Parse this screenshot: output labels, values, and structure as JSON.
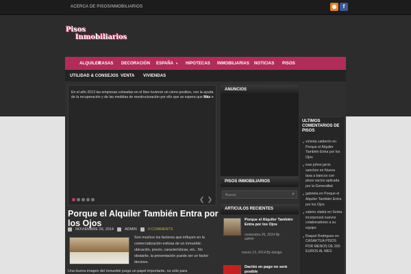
{
  "top": {
    "link": "ACERCA DE PISOSINMOBILIARIOS"
  },
  "social": {
    "rss": "rss-icon",
    "facebook": "f"
  },
  "logo": {
    "line1": "Pisos",
    "line2": "Inmobiliarios"
  },
  "nav": {
    "primary": [
      "ALQUILER",
      "CASAS",
      "DECORACIÓN",
      "ESPAÑA",
      "HIPOTECAS",
      "INMOBILIARIAS",
      "NOTICIAS",
      "PISOS"
    ],
    "dropdown_marker": "▼",
    "secondary": [
      "UTILIDAD & CONSEJOS",
      "VENTA",
      "VIVIENDAS"
    ]
  },
  "slider": {
    "caption": "En el año 2013 las empresas cotizadas en el Ibex tuvieron un cierre positivo, con la ayuda de la recuperación y de las medidas  de reestructuración por ello que se espera que",
    "more": "Más »",
    "prev": "❮",
    "next": "❯"
  },
  "post": {
    "title": "Porque el Alquiler También Entra por los Ojos",
    "date": "NOVIEMBRE 26, 2014",
    "author": "ADMIN",
    "comments": "0 COMMENTS",
    "excerpt": "Son muchos los factores que influyen en la comercialización exitosa de un inmueble: ubicación, precio, características, etc.. No obstante, la presentación puede ser un factor decisivo.",
    "lead": "Una buena imagen del inmueble juega un papel importante, no sólo para"
  },
  "sidebar": {
    "anuncios": "ANUNCIOS",
    "pisos": "PISOS INMOBILIARIOS",
    "search_placeholder": "Buscar",
    "recientes": "ARTICULOS RECIENTES",
    "recent": [
      {
        "title": "Porque el Alquiler También Entra por los Ojos",
        "date": "noviembre 26, 2014 By",
        "author": "admin"
      },
      {
        "title": "",
        "date": "marzo 13, 2014 By danigo",
        "author": ""
      },
      {
        "title": "Dación en pago no será posible",
        "date": "",
        "author": ""
      }
    ]
  },
  "right": {
    "heading": "ULTIMOS COMENTARIOS DE PISOS",
    "comments": [
      "victoria calderón en Porque el Alquiler También Entra por los Ojos",
      "ivan johnn jarrin sanchez en Nueva tasa a bancos con pisos vacíos aplicada por la Generalitat",
      "gabriela en Porque el Alquiler También Entra por los Ojos",
      "valeriu vladut en Solvia incorporará nuevos colaboradores a su equipo",
      "Raquel Rodriguez en CASAKTUA PISOS POR MENOS DE 200 EUROS AL MES"
    ]
  }
}
